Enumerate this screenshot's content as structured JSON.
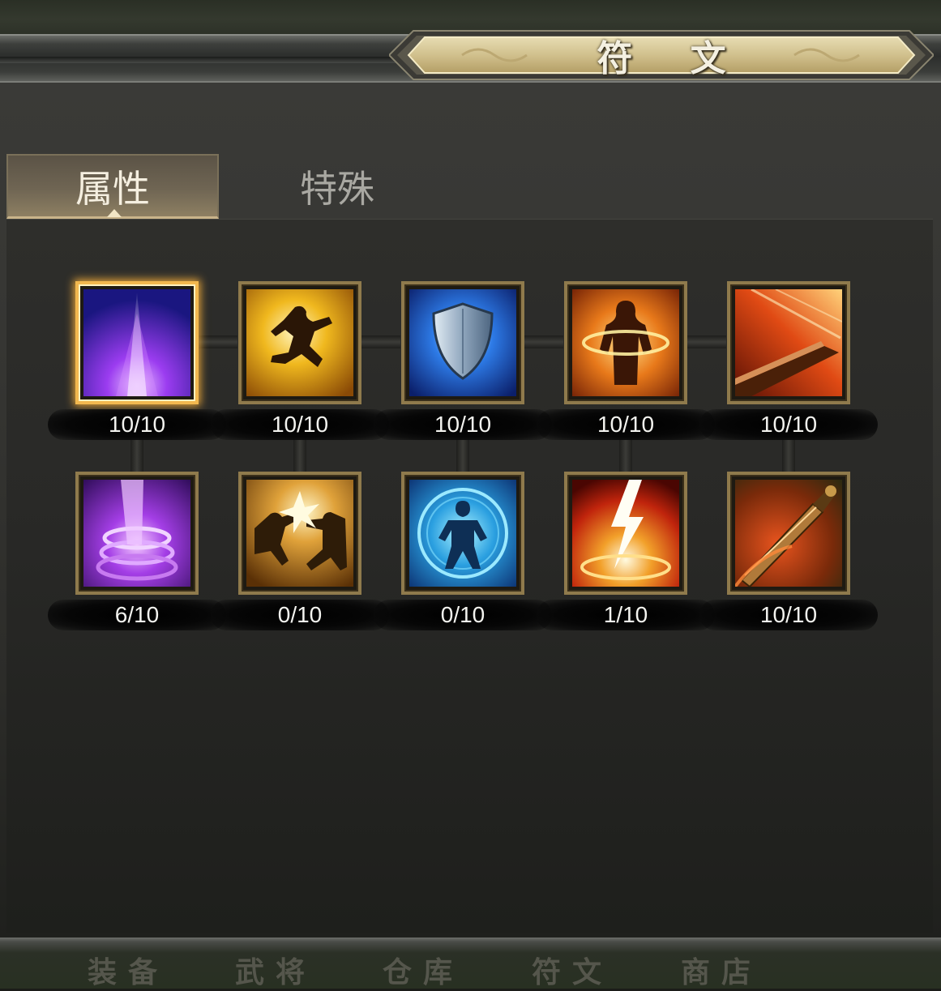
{
  "title": "符 文",
  "tabs": [
    {
      "label": "属性",
      "active": true
    },
    {
      "label": "特殊",
      "active": false
    }
  ],
  "runes": [
    {
      "icon": "purple-light-beam-icon",
      "level": "10/10",
      "selected": true
    },
    {
      "icon": "leaping-warrior-icon",
      "level": "10/10"
    },
    {
      "icon": "blue-shield-icon",
      "level": "10/10"
    },
    {
      "icon": "fire-aura-body-icon",
      "level": "10/10"
    },
    {
      "icon": "flaming-blade-edge-icon",
      "level": "10/10"
    },
    {
      "icon": "purple-vortex-icon",
      "level": "6/10"
    },
    {
      "icon": "dual-strike-icon",
      "level": "0/10"
    },
    {
      "icon": "blue-energy-warrior-icon",
      "level": "0/10"
    },
    {
      "icon": "lightning-strike-icon",
      "level": "1/10"
    },
    {
      "icon": "flaming-sword-icon",
      "level": "10/10"
    }
  ],
  "bottom_nav": [
    "装备",
    "武将",
    "仓库",
    "符文",
    "商店"
  ],
  "colors": {
    "frame_gold": "#8f7a4c",
    "selected_glow": "#f2b84f",
    "panel": "#363633"
  }
}
